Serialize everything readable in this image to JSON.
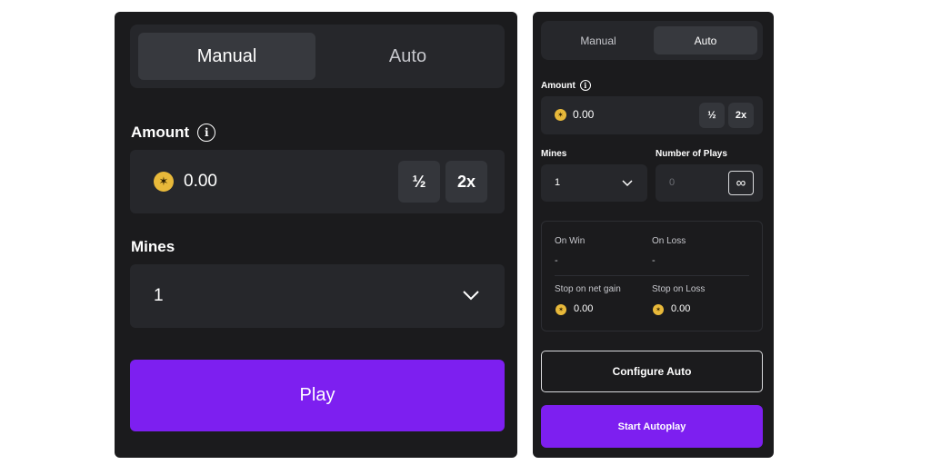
{
  "manual_panel": {
    "tabs": [
      {
        "label": "Manual",
        "active": true
      },
      {
        "label": "Auto",
        "active": false
      }
    ],
    "amount": {
      "label": "Amount",
      "info_icon": "info-icon",
      "value": "0.00",
      "half_label": "½",
      "double_label": "2x",
      "coin_icon": "coin-icon"
    },
    "mines": {
      "label": "Mines",
      "value": "1",
      "dropdown_icon": "chevron-down-icon"
    },
    "play_label": "Play"
  },
  "auto_panel": {
    "tabs": [
      {
        "label": "Manual",
        "active": false
      },
      {
        "label": "Auto",
        "active": true
      }
    ],
    "amount": {
      "label": "Amount",
      "info_icon": "info-icon",
      "value": "0.00",
      "half_label": "½",
      "double_label": "2x",
      "coin_icon": "coin-icon"
    },
    "mines": {
      "label": "Mines",
      "value": "1",
      "dropdown_icon": "chevron-down-icon"
    },
    "plays": {
      "label": "Number of Plays",
      "placeholder": "0",
      "infinity_icon": "infinity-icon",
      "infinity_label": "∞"
    },
    "settings": {
      "on_win_label": "On Win",
      "on_win_value": "-",
      "on_loss_label": "On Loss",
      "on_loss_value": "-",
      "stop_gain_label": "Stop on net gain",
      "stop_gain_value": "0.00",
      "stop_loss_label": "Stop on Loss",
      "stop_loss_value": "0.00"
    },
    "configure_label": "Configure Auto",
    "start_label": "Start Autoplay"
  },
  "colors": {
    "panel_bg": "#1b1b1d",
    "field_bg": "#26272b",
    "accent": "#7d1ff0",
    "coin": "#e8b93a"
  }
}
